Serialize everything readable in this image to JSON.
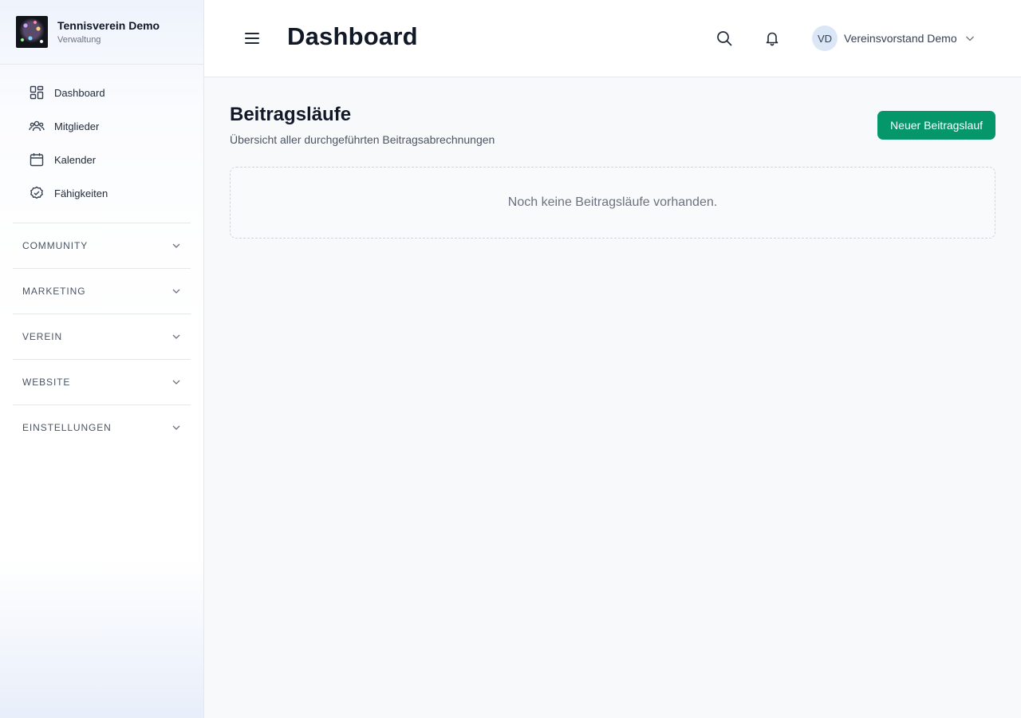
{
  "brand": {
    "title": "Tennisverein Demo",
    "subtitle": "Verwaltung"
  },
  "sidebar": {
    "items": [
      {
        "label": "Dashboard",
        "icon": "dashboard-grid-icon"
      },
      {
        "label": "Mitglieder",
        "icon": "users-icon"
      },
      {
        "label": "Kalender",
        "icon": "calendar-icon"
      },
      {
        "label": "Fähigkeiten",
        "icon": "check-circle-icon"
      }
    ],
    "sections": [
      {
        "label": "COMMUNITY"
      },
      {
        "label": "MARKETING"
      },
      {
        "label": "VEREIN"
      },
      {
        "label": "WEBSITE"
      },
      {
        "label": "EINSTELLUNGEN"
      }
    ]
  },
  "header": {
    "title": "Dashboard",
    "user": {
      "initials": "VD",
      "name": "Vereinsvorstand Demo"
    }
  },
  "main": {
    "title": "Beitragsläufe",
    "subtitle": "Übersicht aller durchgeführten Beitragsabrechnungen",
    "new_button": "Neuer Beitragslauf",
    "empty_text": "Noch keine Beitragsläufe vorhanden."
  },
  "colors": {
    "primary": "#059669",
    "avatar_bg": "#dbe7f7",
    "page_bg": "#f8f9fb"
  }
}
